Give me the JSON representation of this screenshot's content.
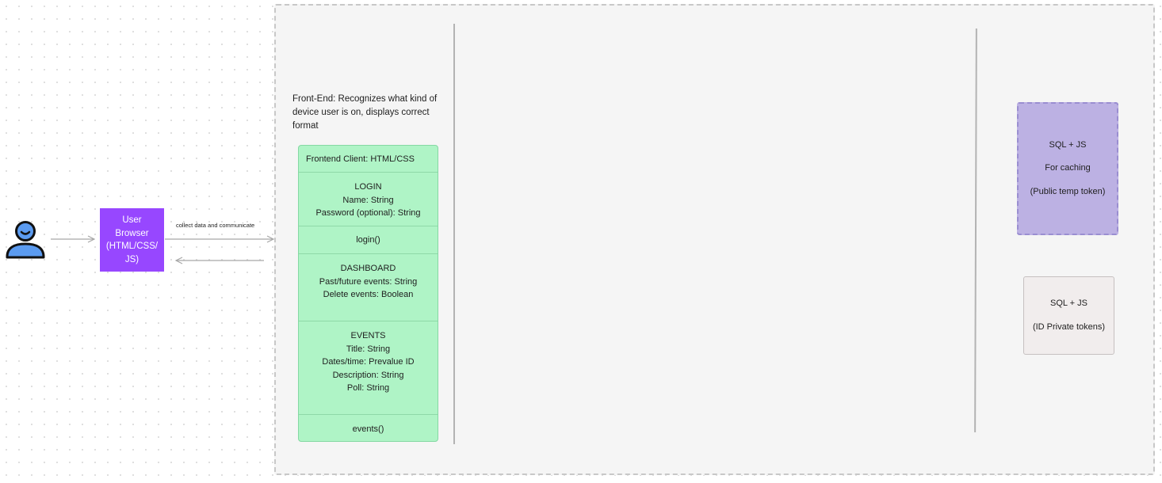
{
  "user": {
    "icon": "person-icon"
  },
  "browser": {
    "label": "User Browser (HTML/CSS/ JS)",
    "color": "#9747ff"
  },
  "connection": {
    "label": "collect data and communicate"
  },
  "frontend": {
    "note": "Front-End: Recognizes what kind of device user is on, displays correct format",
    "card": {
      "header": "Frontend Client: HTML/CSS",
      "login": {
        "title": "LOGIN",
        "fields": [
          "Name: String",
          "Password (optional): String"
        ]
      },
      "login_method": "login()",
      "dashboard": {
        "title": "DASHBOARD",
        "fields": [
          "Past/future events: String",
          "Delete events: Boolean"
        ]
      },
      "events": {
        "title": "EVENTS",
        "fields": [
          "Title: String",
          "Dates/time: Prevalue ID",
          "Description: String",
          "Poll: String"
        ]
      },
      "events_method": "events()",
      "color": "#aff4c6"
    }
  },
  "databases": {
    "cache": {
      "line1": "SQL + JS",
      "line2": "For caching",
      "line3": "(Public temp token)",
      "color": "#bcb1e3"
    },
    "private": {
      "line1": "SQL + JS",
      "line2": "(ID Private tokens)",
      "color": "#f1eded"
    }
  }
}
